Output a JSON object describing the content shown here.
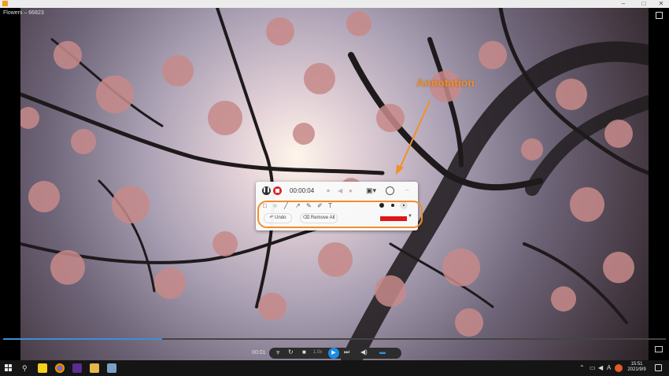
{
  "window": {
    "title": "Flowers – 66823",
    "controls": [
      "–",
      "□",
      "✕"
    ]
  },
  "recorder": {
    "timer": "00:00:04",
    "undo_label": "Undo",
    "remove_all_label": "Remove All",
    "text_tool_label": "T",
    "selected_color": "#e01515"
  },
  "annotation": {
    "label": "Annotation",
    "color": "#f18f2b"
  },
  "player": {
    "time": "00:01",
    "speed_label": "1.0x",
    "progress_fraction": 0.24
  },
  "taskbar": {
    "clock_time": "15:51",
    "clock_date": "2021/9/9",
    "ime_label": "A"
  }
}
